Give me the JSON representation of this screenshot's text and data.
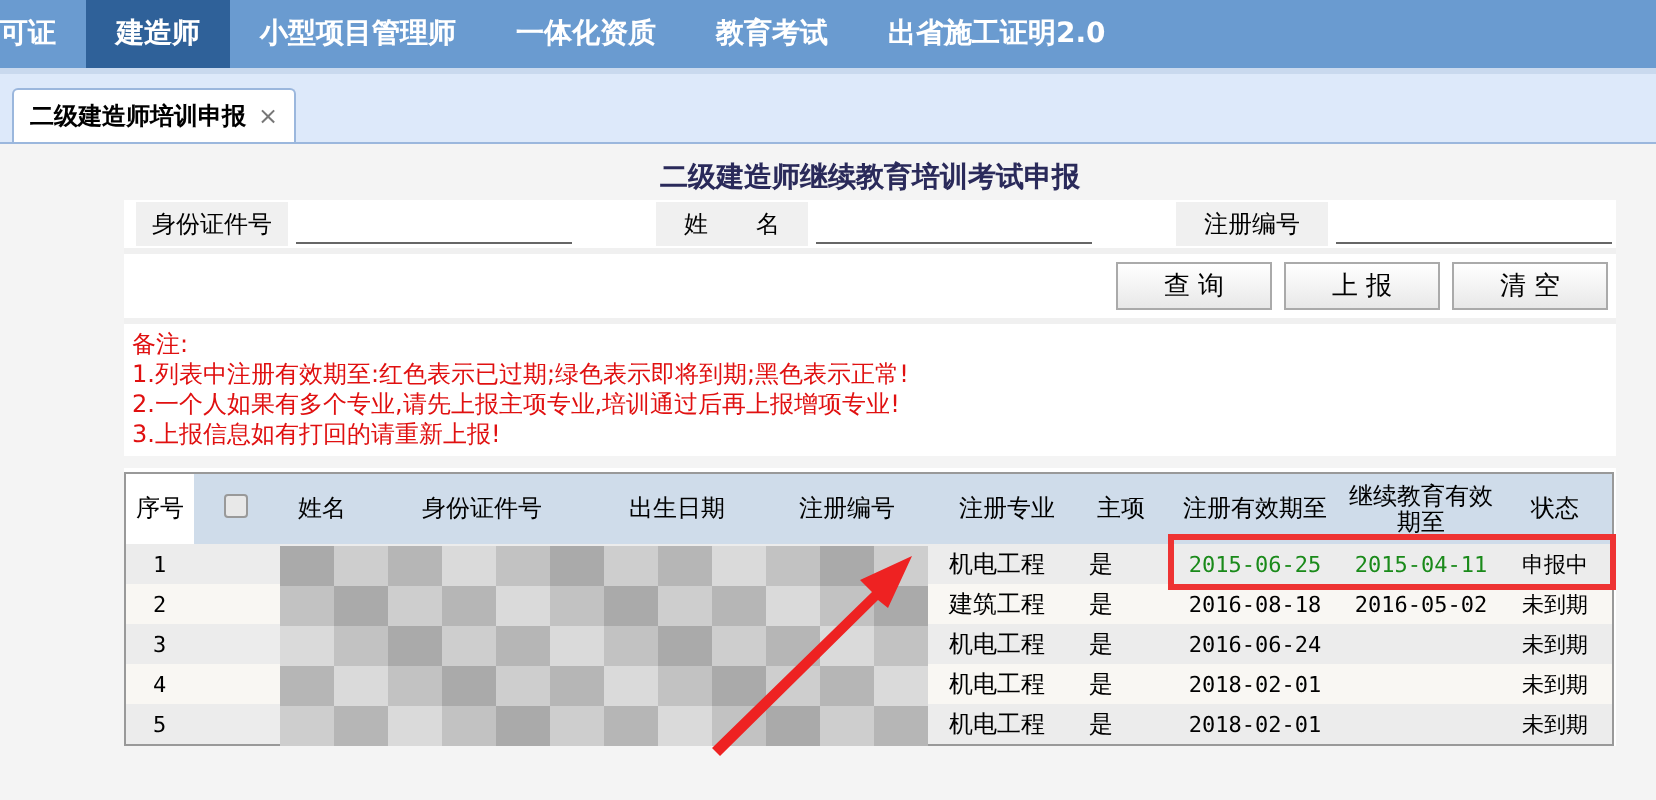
{
  "nav": [
    {
      "label": "可证",
      "selected": false
    },
    {
      "label": "建造师",
      "selected": true
    },
    {
      "label": "小型项目管理师",
      "selected": false
    },
    {
      "label": "一体化资质",
      "selected": false
    },
    {
      "label": "教育考试",
      "selected": false
    },
    {
      "label": "出省施工证明2.0",
      "selected": false
    }
  ],
  "tabs": [
    {
      "label": "二级建造师培训申报",
      "close": "×",
      "selected": true
    }
  ],
  "title": "二级建造师继续教育培训考试申报",
  "fields": [
    {
      "label": "身份证件号"
    },
    {
      "label": "姓　　名"
    },
    {
      "label": "注册编号"
    }
  ],
  "buttons": [
    "查 询",
    "上 报",
    "清 空"
  ],
  "notes": [
    "备注:",
    "1.列表中注册有效期至:红色表示已过期;绿色表示即将到期;黑色表示正常!",
    "2.一个人如果有多个专业,请先上报主项专业,培训通过后再上报增项专业!",
    "3.上报信息如有打回的请重新上报!"
  ],
  "table": {
    "columns": [
      "序号",
      "姓名",
      "身份证件号",
      "出生日期",
      "注册编号",
      "注册专业",
      "主项",
      "注册有效期至",
      "继续教育有效期至",
      "状态"
    ],
    "select_all": {
      "checked": false
    },
    "rows": [
      {
        "index": "1",
        "major": "机电工程",
        "primary": "是",
        "reg_expiry": "2015-06-25",
        "edu_expiry": "2015-04-11",
        "color": "#1a8a1a",
        "status": "申报中"
      },
      {
        "index": "2",
        "major": "建筑工程",
        "primary": "是",
        "reg_expiry": "2016-08-18",
        "edu_expiry": "2016-05-02",
        "color": "#000000",
        "status": "未到期"
      },
      {
        "index": "3",
        "major": "机电工程",
        "primary": "是",
        "reg_expiry": "2016-06-24",
        "color": "#000000",
        "status": "未到期"
      },
      {
        "index": "4",
        "major": "机电工程",
        "primary": "是",
        "reg_expiry": "2018-02-01",
        "color": "#000000",
        "status": "未到期"
      },
      {
        "index": "5",
        "major": "机电工程",
        "primary": "是",
        "reg_expiry": "2018-02-01",
        "color": "#000000",
        "status": "未到期"
      }
    ]
  }
}
